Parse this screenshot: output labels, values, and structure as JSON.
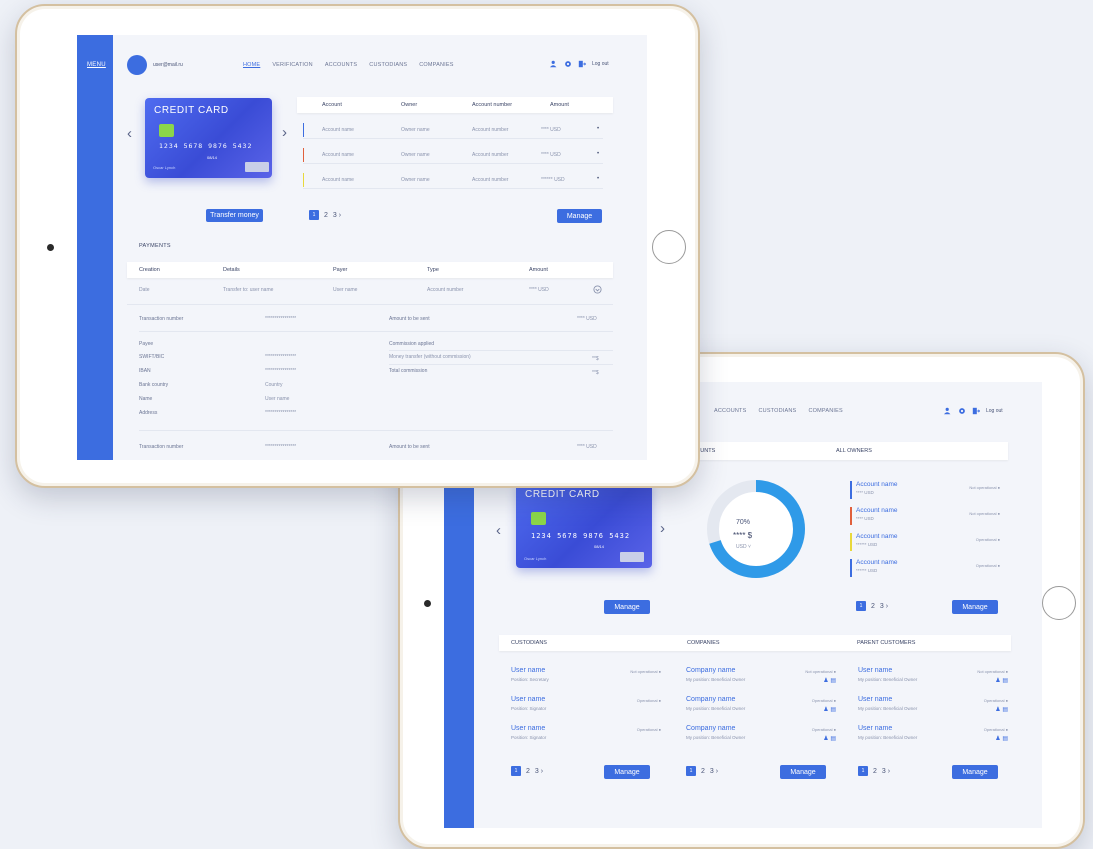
{
  "screen1": {
    "menu": "MENU",
    "email": "user@mail.ru",
    "nav": [
      "HOME",
      "VERIFICATION",
      "ACCOUNTS",
      "CUSTODIANS",
      "COMPANIES"
    ],
    "logout": "Log out",
    "card": {
      "title": "CREDIT CARD",
      "number": "1234 5678 9876 5432",
      "expiry": "08/14",
      "holder": "Oscar Lynch"
    },
    "accounts": {
      "headers": [
        "Account",
        "Owner",
        "Account number",
        "Amount"
      ],
      "rows": [
        {
          "account": "Account name",
          "owner": "Owner name",
          "number": "Account number",
          "amount": "**** USD",
          "color": "#3c6de0"
        },
        {
          "account": "Account name",
          "owner": "Owner name",
          "number": "Account number",
          "amount": "**** USD",
          "color": "#e0603c"
        },
        {
          "account": "Account name",
          "owner": "Owner name",
          "number": "Account number",
          "amount": "****** USD",
          "color": "#e8d83c"
        }
      ]
    },
    "transfer_button": "Transfer money",
    "pager": {
      "current": "1",
      "next": "2",
      "more": "3 ›"
    },
    "manage_button": "Manage",
    "payments": {
      "title": "PAYMENTS",
      "headers": [
        "Creation",
        "Details",
        "Payer",
        "Type",
        "Amount"
      ],
      "row": {
        "date": "Date",
        "details": "Transfer to: user name",
        "payer": "User name",
        "type": "Account number",
        "amount": "**** USD"
      }
    },
    "transaction": {
      "label": "Transaction number",
      "value": "****************",
      "amount_label": "Amount to be sent",
      "amount_value": "**** USD"
    },
    "details": {
      "payee": "Payee",
      "swift": "SWIFT/BIC",
      "iban": "IBAN",
      "bank_country": "Bank country",
      "name": "Name",
      "address": "Address",
      "swift_val": "****************",
      "iban_val": "****************",
      "country_val": "Country",
      "name_val": "User name",
      "address_val": "****************",
      "commission_applied": "Commission applied",
      "money_transfer": "Money transfer (without commission)",
      "money_val": "**$",
      "total_commission": "Total commission",
      "total_val": "**$"
    },
    "transaction2": {
      "label": "Transaction number",
      "value": "****************",
      "amount_label": "Amount to be sent",
      "amount_value": "**** USD"
    }
  },
  "screen2": {
    "nav": [
      "ACCOUNTS",
      "CUSTODIANS",
      "COMPANIES"
    ],
    "logout": "Log out",
    "accounts_head": "OUNTS",
    "owners_head": "ALL OWNERS",
    "card": {
      "title": "CREDIT CARD",
      "number": "1234 5678 9876 5432",
      "expiry": "08/14",
      "holder": "Oscar Lynch"
    },
    "gauge": {
      "percent_label": "70%",
      "percent_value": 0.7,
      "amount": "**** $",
      "currency": "USD ˅"
    },
    "owners": [
      {
        "name": "Account name",
        "amount": "**** USD",
        "status": "Not operational ●",
        "color": "#3c6de0"
      },
      {
        "name": "Account name",
        "amount": "**** USD",
        "status": "Not operational ●",
        "color": "#e0603c"
      },
      {
        "name": "Account name",
        "amount": "****** USD",
        "status": "Operational ●",
        "color": "#e8d83c"
      },
      {
        "name": "Account name",
        "amount": "****** USD",
        "status": "Operational ●",
        "color": "#3c6de0"
      }
    ],
    "manage": "Manage",
    "pager": {
      "current": "1",
      "next": "2",
      "more": "3 ›"
    },
    "custodians": {
      "title": "CUSTODIANS",
      "items": [
        {
          "name": "User name",
          "sub": "Position: Secretary",
          "status": "Not operational ●"
        },
        {
          "name": "User name",
          "sub": "Position: Signator",
          "status": "Operational ●"
        },
        {
          "name": "User name",
          "sub": "Position: Signator",
          "status": "Operational ●"
        }
      ]
    },
    "companies": {
      "title": "COMPANIES",
      "items": [
        {
          "name": "Company name",
          "sub": "My position: Beneficial Owner",
          "status": "Not operational ●"
        },
        {
          "name": "Company name",
          "sub": "My position: Beneficial Owner",
          "status": "Operational ●"
        },
        {
          "name": "Company name",
          "sub": "My position: Beneficial Owner",
          "status": "Operational ●"
        }
      ]
    },
    "parents": {
      "title": "PARENT CUSTOMERS",
      "items": [
        {
          "name": "User name",
          "sub": "My position: Beneficial Owner",
          "status": "Not operational ●"
        },
        {
          "name": "User name",
          "sub": "My position: Beneficial Owner",
          "status": "Operational ●"
        },
        {
          "name": "User name",
          "sub": "My position: Beneficial Owner",
          "status": "Operational ●"
        }
      ]
    }
  }
}
